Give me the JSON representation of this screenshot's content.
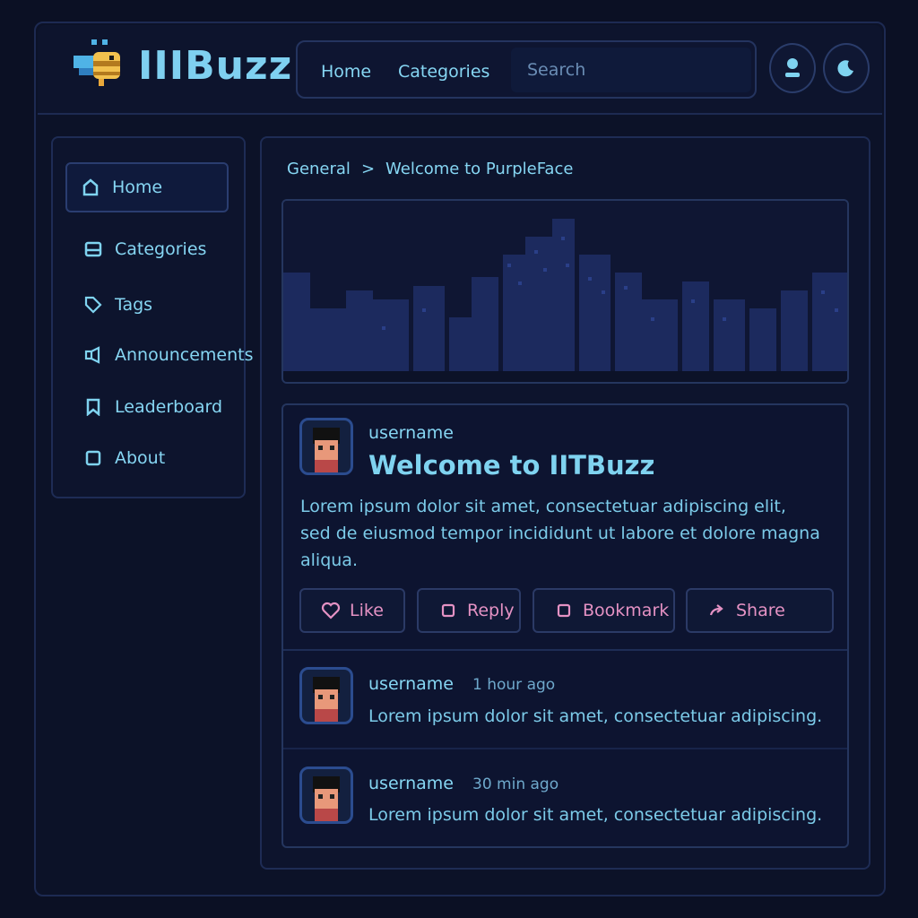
{
  "app": {
    "brand": "IIIBuzz"
  },
  "nav": {
    "home": "Home",
    "categories": "Categories",
    "search_placeholder": "Search"
  },
  "sidebar": {
    "items": [
      {
        "label": "Home",
        "icon": "home-icon"
      },
      {
        "label": "Categories",
        "icon": "categories-icon"
      },
      {
        "label": "Tags",
        "icon": "tag-icon"
      },
      {
        "label": "Announcements",
        "icon": "megaphone-icon"
      },
      {
        "label": "Leaderboard",
        "icon": "bookmark-icon"
      },
      {
        "label": "About",
        "icon": "about-icon"
      }
    ]
  },
  "breadcrumb": {
    "parent": "General",
    "separator": ">",
    "current": "Welcome to PurpleFace"
  },
  "post": {
    "username": "username",
    "title": "Welcome to IITBuzz",
    "body": "Lorem ipsum dolor sit amet, consectetuar adipiscing elit, sed de eiusmod tempor incididunt ut labore et dolore magna aliqua.",
    "actions": {
      "like": "Like",
      "reply": "Reply",
      "bookmark": "Bookmark",
      "share": "Share"
    }
  },
  "comments": [
    {
      "username": "username",
      "time": "1 hour ago",
      "text": "Lorem ipsum dolor sit amet, consectetuar adipiscing."
    },
    {
      "username": "username",
      "time": "30 min  ago",
      "text": "Lorem ipsum dolor sit amet, consectetuar adipiscing."
    }
  ],
  "colors": {
    "accent": "#7fd3f0",
    "action": "#e592c4",
    "background": "#0b1024",
    "border": "#1e2c55"
  }
}
